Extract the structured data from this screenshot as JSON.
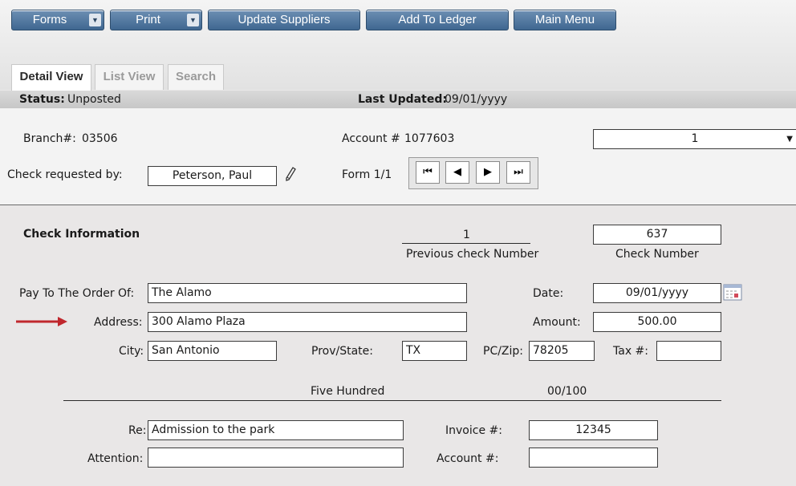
{
  "toolbar": {
    "forms_label": "Forms",
    "print_label": "Print",
    "update_suppliers_label": "Update Suppliers",
    "add_to_ledger_label": "Add To Ledger",
    "main_menu_label": "Main Menu",
    "dropdown_glyph": "▼"
  },
  "tabs": {
    "detail": "Detail View",
    "list": "List View",
    "search": "Search"
  },
  "status": {
    "label": "Status:",
    "value": "Unposted",
    "last_updated_label": "Last Updated:",
    "last_updated_value": "09/01/yyyy"
  },
  "header": {
    "branch_label": "Branch#:",
    "branch_value": "03506",
    "account_label": "Account #",
    "account_value": "1077603",
    "form_select_value": "1",
    "requested_by_label": "Check requested by:",
    "requested_by_value": "Peterson, Paul",
    "form_label": "Form 1/1",
    "nav": {
      "first": "⏮",
      "prev": "◀",
      "next": "▶",
      "last": "⏭"
    }
  },
  "check": {
    "section_title": "Check Information",
    "previous_check_value": "1",
    "previous_check_label": "Previous check Number",
    "check_number_value": "637",
    "check_number_label": "Check Number",
    "pay_to_label": "Pay To The Order Of:",
    "pay_to_value": "The Alamo",
    "date_label": "Date:",
    "date_value": "09/01/yyyy",
    "address_label": "Address:",
    "address_value": "300 Alamo Plaza",
    "amount_label": "Amount:",
    "amount_value": "500.00",
    "city_label": "City:",
    "city_value": "San Antonio",
    "prov_state_label": "Prov/State:",
    "prov_state_value": "TX",
    "pc_zip_label": "PC/Zip:",
    "pc_zip_value": "78205",
    "tax_label": "Tax #:",
    "tax_value": "",
    "amount_words": "Five Hundred",
    "amount_cents": "00/100",
    "re_label": "Re:",
    "re_value": "Admission to the park",
    "invoice_label": "Invoice #:",
    "invoice_value": "12345",
    "attention_label": "Attention:",
    "attention_value": "",
    "account2_label": "Account #:",
    "account2_value": ""
  },
  "colors": {
    "button_blue": "#4f76a0",
    "arrow_red": "#c0272d"
  }
}
